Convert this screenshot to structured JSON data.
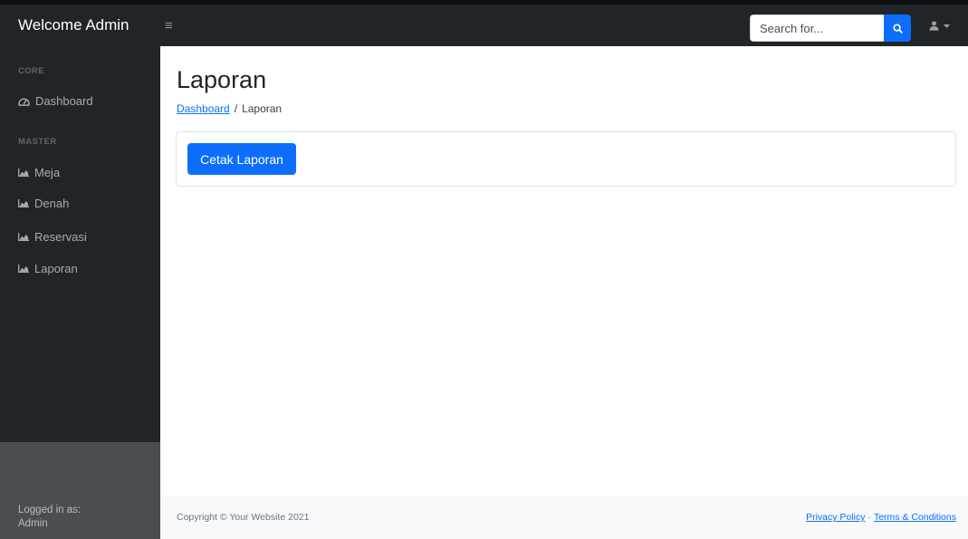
{
  "topbar": {
    "brand": "Welcome Admin",
    "toggle_icon": "hamburger-icon",
    "search": {
      "placeholder": "Search for...",
      "value": "",
      "button_icon": "search-icon"
    },
    "user_icon": "user-icon",
    "caret_icon": "caret-down-icon"
  },
  "sidebar": {
    "sections": [
      {
        "heading": "CORE",
        "items": [
          {
            "label": "Dashboard",
            "icon": "tachometer-icon"
          }
        ]
      },
      {
        "heading": "MASTER",
        "items": [
          {
            "label": "Meja",
            "icon": "chart-area-icon"
          },
          {
            "label": "Denah",
            "icon": "chart-area-icon"
          },
          {
            "label": "Reservasi",
            "icon": "chart-area-icon"
          },
          {
            "label": "Laporan",
            "icon": "chart-area-icon"
          }
        ]
      }
    ],
    "footer": {
      "label": "Logged in as:",
      "user": "Admin"
    }
  },
  "main": {
    "title": "Laporan",
    "breadcrumb": {
      "link": "Dashboard",
      "separator": "/",
      "current": "Laporan"
    },
    "print_button": "Cetak Laporan"
  },
  "footer": {
    "copyright": "Copyright © Your Website 2021",
    "privacy": "Privacy Policy",
    "separator": "·",
    "terms": "Terms & Conditions"
  },
  "colors": {
    "nav_bg": "#212529",
    "primary": "#0d6efd",
    "sidebar_footer_bg": "#4a4e53",
    "footer_bg": "#f8f9fa"
  }
}
